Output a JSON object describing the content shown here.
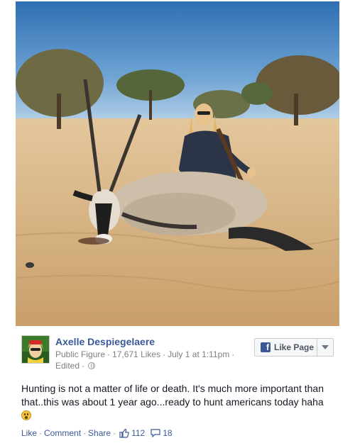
{
  "post": {
    "author": "Axelle Despiegelaere",
    "category": "Public Figure",
    "likes_count": "17,671 Likes",
    "timestamp": "July 1 at 1:11pm",
    "edited": "Edited",
    "privacy_icon": "globe-icon",
    "text": "Hunting is not a matter of life or death. It's much more important than that..this was about 1 year ago...ready to hunt americans today haha",
    "emoji_icon": "gasp-emoji-icon",
    "photo_icon": "hunting-photo"
  },
  "like_page": {
    "label": "Like Page",
    "icon": "facebook-icon",
    "dropdown_icon": "caret-down-icon"
  },
  "actions": {
    "like": "Like",
    "comment": "Comment",
    "share": "Share",
    "like_count": "112",
    "comment_count": "18"
  },
  "colors": {
    "link": "#3b5998",
    "meta": "#7f7f7f",
    "text": "#141823"
  }
}
